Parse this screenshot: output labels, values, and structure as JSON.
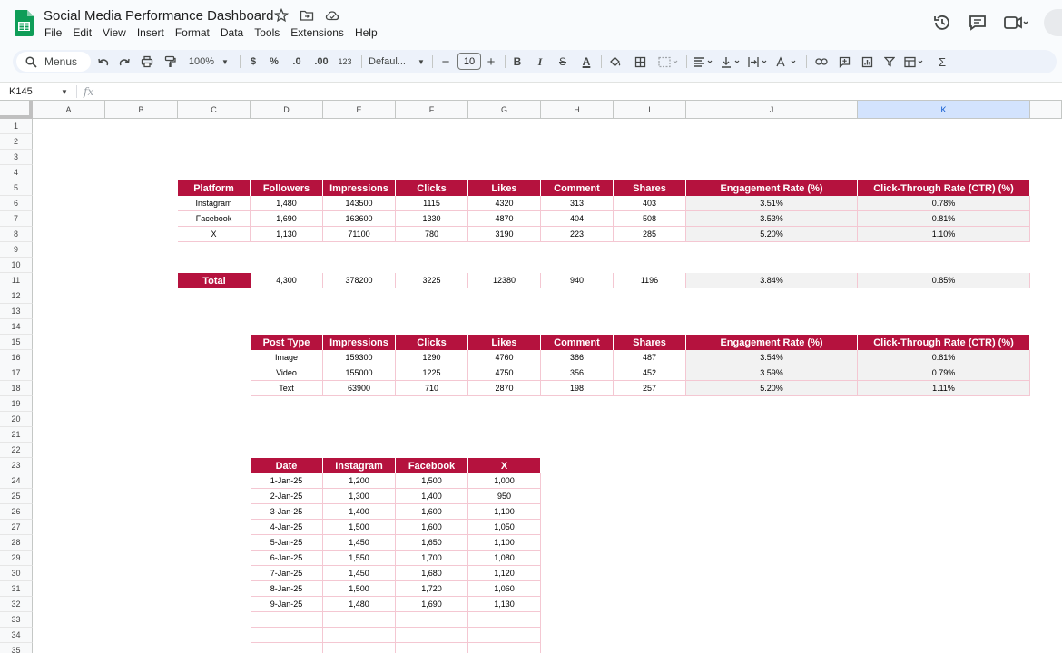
{
  "app": {
    "title": "Social Media Performance Dashboard",
    "menus": [
      "File",
      "Edit",
      "View",
      "Insert",
      "Format",
      "Data",
      "Tools",
      "Extensions",
      "Help"
    ]
  },
  "toolbar": {
    "search_label": "Menus",
    "zoom": "100%",
    "currency": "$",
    "percent": "%",
    "dec_decrease": ".0",
    "dec_increase": ".00",
    "number_format": "123",
    "font": "Defaul...",
    "font_size": "10",
    "minus": "−",
    "plus": "+",
    "bold": "B",
    "italic": "I",
    "strike": "S",
    "text_color": "A",
    "sum": "Σ"
  },
  "formula": {
    "name_box": "K145",
    "fx": "fx"
  },
  "colors": {
    "header_bg": "#b5123e",
    "accent": "#0b57d0"
  },
  "grid": {
    "columns": [
      "A",
      "B",
      "C",
      "D",
      "E",
      "F",
      "G",
      "H",
      "I",
      "J",
      "K"
    ],
    "rows": [
      "1",
      "2",
      "3",
      "4",
      "5",
      "6",
      "7",
      "8",
      "9",
      "10",
      "11",
      "12",
      "13",
      "14",
      "15",
      "16",
      "17",
      "18",
      "19",
      "20",
      "21",
      "22",
      "23",
      "24",
      "25",
      "26",
      "27",
      "28",
      "29",
      "30",
      "31",
      "32",
      "33",
      "34",
      "35"
    ]
  },
  "platform_table": {
    "headers": [
      "Platform",
      "Followers",
      "Impressions",
      "Clicks",
      "Likes",
      "Comment",
      "Shares",
      "Engagement Rate (%)",
      "Click-Through Rate (CTR) (%)"
    ],
    "rows": [
      [
        "Instagram",
        "1,480",
        "143500",
        "1115",
        "4320",
        "313",
        "403",
        "3.51%",
        "0.78%"
      ],
      [
        "Facebook",
        "1,690",
        "163600",
        "1330",
        "4870",
        "404",
        "508",
        "3.53%",
        "0.81%"
      ],
      [
        "X",
        "1,130",
        "71100",
        "780",
        "3190",
        "223",
        "285",
        "5.20%",
        "1.10%"
      ]
    ]
  },
  "total_row": {
    "label": "Total",
    "values": [
      "4,300",
      "378200",
      "3225",
      "12380",
      "940",
      "1196",
      "3.84%",
      "0.85%"
    ]
  },
  "post_table": {
    "headers": [
      "Post Type",
      "Impressions",
      "Clicks",
      "Likes",
      "Comment",
      "Shares",
      "Engagement Rate (%)",
      "Click-Through Rate (CTR) (%)"
    ],
    "rows": [
      [
        "Image",
        "159300",
        "1290",
        "4760",
        "386",
        "487",
        "3.54%",
        "0.81%"
      ],
      [
        "Video",
        "155000",
        "1225",
        "4750",
        "356",
        "452",
        "3.59%",
        "0.79%"
      ],
      [
        "Text",
        "63900",
        "710",
        "2870",
        "198",
        "257",
        "5.20%",
        "1.11%"
      ]
    ]
  },
  "date_table": {
    "headers": [
      "Date",
      "Instagram",
      "Facebook",
      "X"
    ],
    "rows": [
      [
        "1-Jan-25",
        "1,200",
        "1,500",
        "1,000"
      ],
      [
        "2-Jan-25",
        "1,300",
        "1,400",
        "950"
      ],
      [
        "3-Jan-25",
        "1,400",
        "1,600",
        "1,100"
      ],
      [
        "4-Jan-25",
        "1,500",
        "1,600",
        "1,050"
      ],
      [
        "5-Jan-25",
        "1,450",
        "1,650",
        "1,100"
      ],
      [
        "6-Jan-25",
        "1,550",
        "1,700",
        "1,080"
      ],
      [
        "7-Jan-25",
        "1,450",
        "1,680",
        "1,120"
      ],
      [
        "8-Jan-25",
        "1,500",
        "1,720",
        "1,060"
      ],
      [
        "9-Jan-25",
        "1,480",
        "1,690",
        "1,130"
      ]
    ]
  }
}
